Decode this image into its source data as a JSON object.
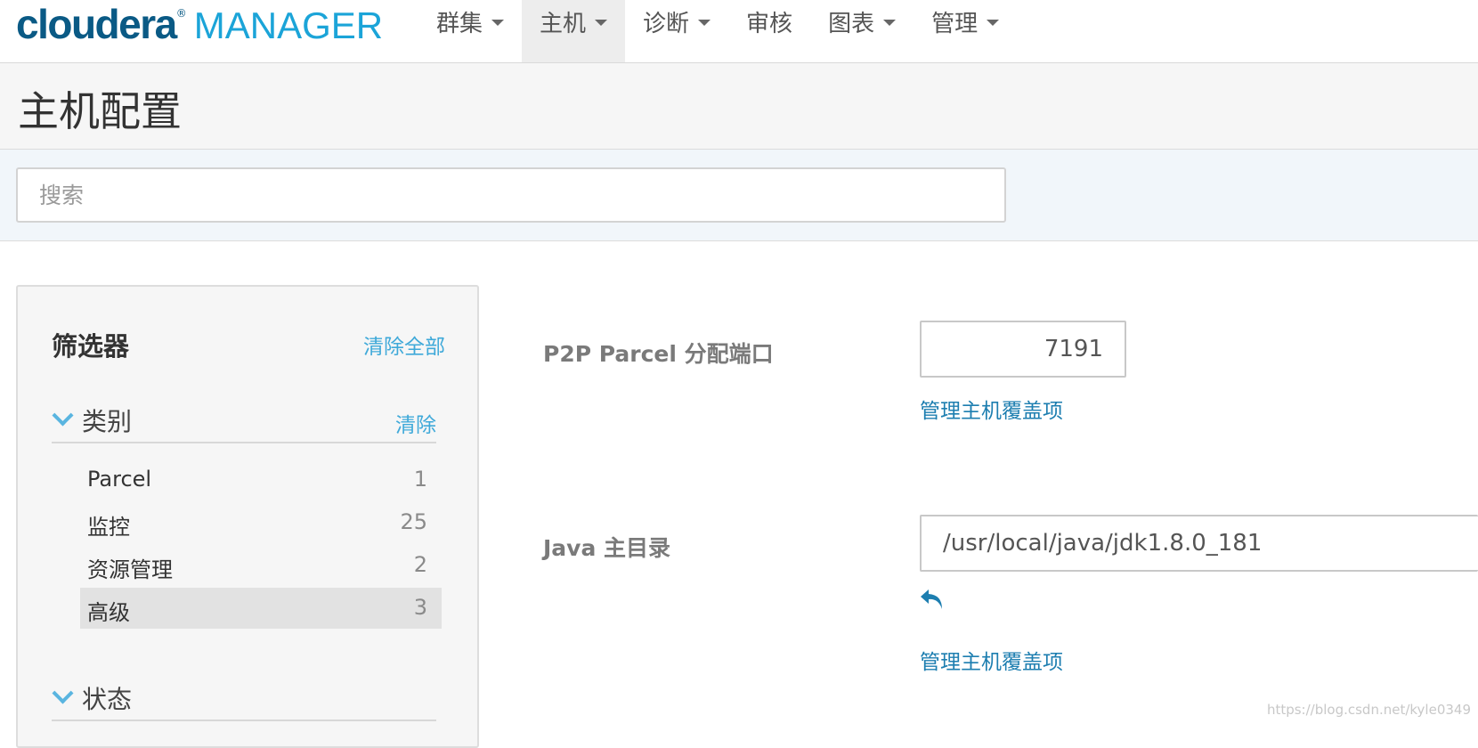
{
  "logo": {
    "brand": "cloudera",
    "registered": "®",
    "product": "MANAGER"
  },
  "nav": [
    {
      "label": "群集",
      "has_caret": true
    },
    {
      "label": "主机",
      "has_caret": true,
      "active": true
    },
    {
      "label": "诊断",
      "has_caret": true
    },
    {
      "label": "审核",
      "has_caret": false
    },
    {
      "label": "图表",
      "has_caret": true
    },
    {
      "label": "管理",
      "has_caret": true
    }
  ],
  "page": {
    "title": "主机配置"
  },
  "search": {
    "placeholder": "搜索",
    "value": ""
  },
  "filter": {
    "title": "筛选器",
    "clear_all": "清除全部",
    "category": {
      "label": "类别",
      "clear": "清除",
      "items": [
        {
          "label": "Parcel",
          "count": "1"
        },
        {
          "label": "监控",
          "count": "25"
        },
        {
          "label": "资源管理",
          "count": "2"
        },
        {
          "label": "高级",
          "count": "3",
          "active": true
        }
      ]
    },
    "status": {
      "label": "状态"
    }
  },
  "configs": [
    {
      "label": "P2P Parcel 分配端口",
      "value": "7191",
      "override_link": "管理主机覆盖项"
    },
    {
      "label": "Java 主目录",
      "value": "/usr/local/java/jdk1.8.0_181",
      "override_link": "管理主机覆盖项",
      "undo_icon": "undo-arrow-icon"
    }
  ],
  "colors": {
    "brand_dark": "#0a5a85",
    "brand_light": "#1ba4d8",
    "link": "#1d7eb0",
    "accent": "#3fa9d9"
  },
  "watermark": "https://blog.csdn.net/kyle0349"
}
